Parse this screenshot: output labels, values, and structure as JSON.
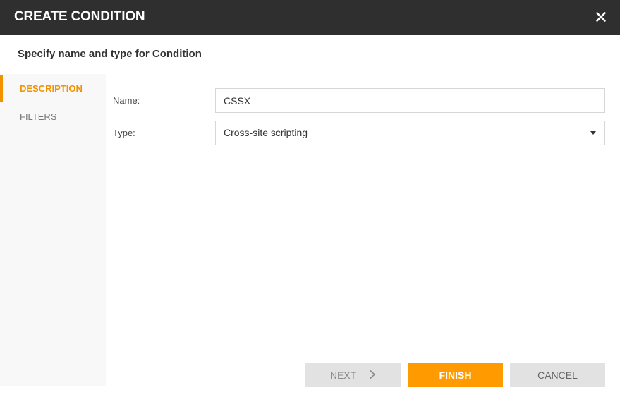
{
  "dialog": {
    "title": "CREATE CONDITION",
    "subtitle": "Specify name and type for Condition",
    "close_icon": "close-icon"
  },
  "sidebar": {
    "items": [
      {
        "label": "DESCRIPTION",
        "active": true
      },
      {
        "label": "FILTERS",
        "active": false
      }
    ]
  },
  "form": {
    "name_label": "Name:",
    "name_value": "CSSX",
    "type_label": "Type:",
    "type_value": "Cross-site scripting"
  },
  "buttons": {
    "next": "NEXT",
    "finish": "FINISH",
    "cancel": "CANCEL"
  },
  "colors": {
    "accent": "#ff9a00",
    "titlebar": "#2f2f2f",
    "active_tab": "#f39200"
  }
}
